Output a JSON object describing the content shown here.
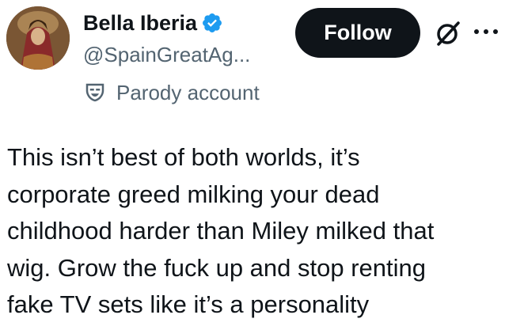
{
  "author": {
    "display_name": "Bella Iberia",
    "handle": "@SpainGreatAg...",
    "label": "Parody account",
    "verified": true
  },
  "actions": {
    "follow_label": "Follow",
    "grok_icon": "grok-icon",
    "more_icon": "more-icon"
  },
  "tweet": {
    "lines": [
      "This isn’t best of both worlds,  it’s",
      "corporate greed milking your dead",
      "childhood harder than Miley milked that",
      "wig. Grow the fuck up and stop renting",
      "fake TV sets like it’s a personality"
    ]
  },
  "colors": {
    "text": "#0f1419",
    "secondary": "#536471",
    "verified": "#1d9bf0",
    "follow_bg": "#0f1419"
  }
}
